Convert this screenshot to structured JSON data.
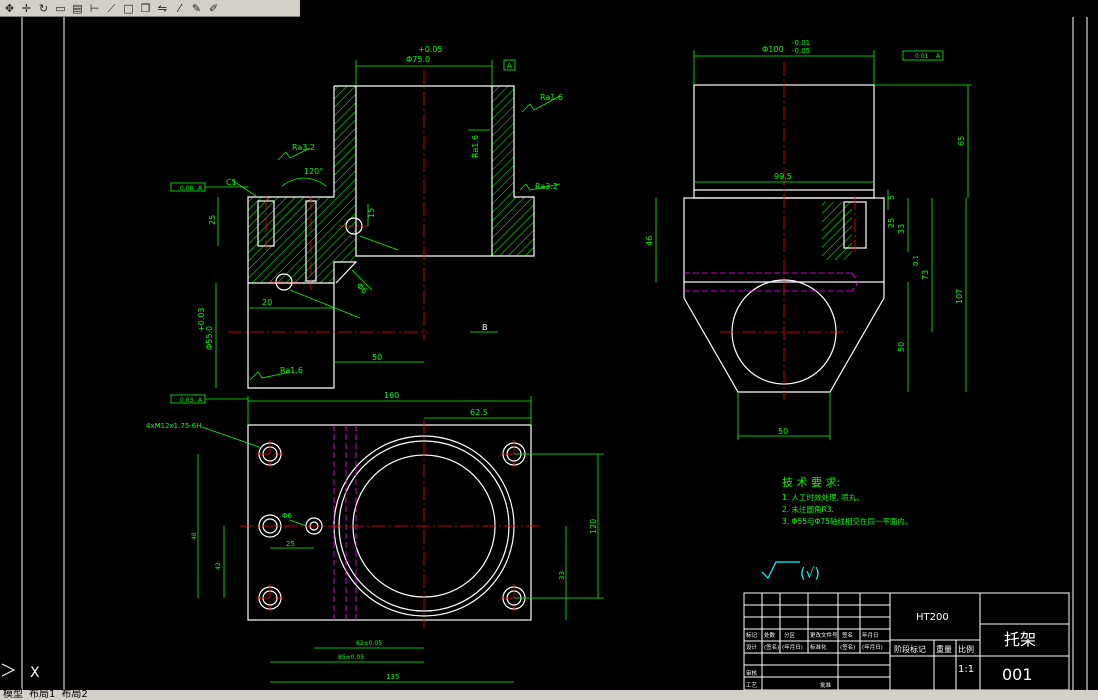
{
  "toolbar": {
    "icons": [
      "pan-icon",
      "move-icon",
      "rotate-icon",
      "zoom-window-icon",
      "properties-icon",
      "dimension-linear-icon",
      "dimension-aligned-icon",
      "rectangle-icon",
      "copy-icon",
      "mirror-icon",
      "trim-icon",
      "pencil-icon",
      "brush-icon"
    ]
  },
  "status": {
    "tabs": [
      "模型",
      "布局1",
      "布局2"
    ]
  },
  "colors": {
    "background": "#000000",
    "outline": "#ffffff",
    "dimension": "#00ff00",
    "hatch": "#00ff00",
    "centerline": "#ff0000",
    "hidden": "#ff00ff",
    "note": "#00ff00"
  },
  "front_view": {
    "dims": {
      "top_tol": "+0.05",
      "top_dia": "Φ75.0",
      "ra_top": "Ra1.6",
      "ra_bore": "Ra1.6",
      "ra_step": "Ra3.2",
      "ra_left": "Ra3.2",
      "angle": "120°",
      "chamfer": "C1",
      "ftol_left": "0.08",
      "ftol_left_ref": "A",
      "d25": "25",
      "d15": "15",
      "d20": "20",
      "d50": "50",
      "ra_bottom": "Ra1.6",
      "dia55": "Φ55.0",
      "dia55_tol": "+0.03",
      "dia6": "Φ6",
      "ftol_bottom": "0.03",
      "ftol_bottom_ref": "A",
      "datum_top": "A",
      "arrow_b": "B"
    }
  },
  "side_view": {
    "dims": {
      "top_dia": "Φ100",
      "top_tol_upper": "-0.01",
      "top_tol_lower": "-0.05",
      "ftol_label": "0.01",
      "ftol_ref": "A",
      "d65": "65",
      "d99_5": "99.5",
      "d5": "5",
      "d46": "46",
      "d25": "25",
      "d33": "33",
      "d73": "73",
      "d73_tol": "0.1",
      "d107": "107",
      "d50v": "50",
      "d50h": "50"
    }
  },
  "top_view": {
    "dims": {
      "d160": "160",
      "d62_5": "62.5",
      "thread": "4xM12x1.75-6H",
      "d120": "120",
      "d48": "48",
      "d33": "33",
      "d25": "25",
      "dia6": "Φ6",
      "d42": "42",
      "d38": "38",
      "d62": "62±0.05",
      "d85": "85±0.05",
      "d135": "135"
    }
  },
  "tech_requirements": {
    "title": "技 术 要 求:",
    "lines": [
      "1. 人工时效处理, 喷丸。",
      "2. 未注圆角R3.",
      "3. Φ55与Φ75轴线相交在同一平面内。"
    ]
  },
  "roughness_symbol": {
    "label": "(√)"
  },
  "title_block": {
    "material": "HT200",
    "part_name": "托架",
    "drawing_no": "001",
    "scale": "1:1",
    "stage_label": "阶段标记",
    "weight_label": "重量",
    "scale_label": "比例",
    "row_labels": [
      "标记",
      "处数",
      "分区",
      "更改文件号",
      "签名",
      "年月日"
    ],
    "design_row": [
      "设计",
      "(签名)",
      "(年月日)",
      "标准化",
      "(签名)",
      "(年月日)"
    ],
    "review_label": "审核",
    "process_label": "工艺",
    "approve_label": "批准"
  },
  "ucs": {
    "label": "X"
  }
}
